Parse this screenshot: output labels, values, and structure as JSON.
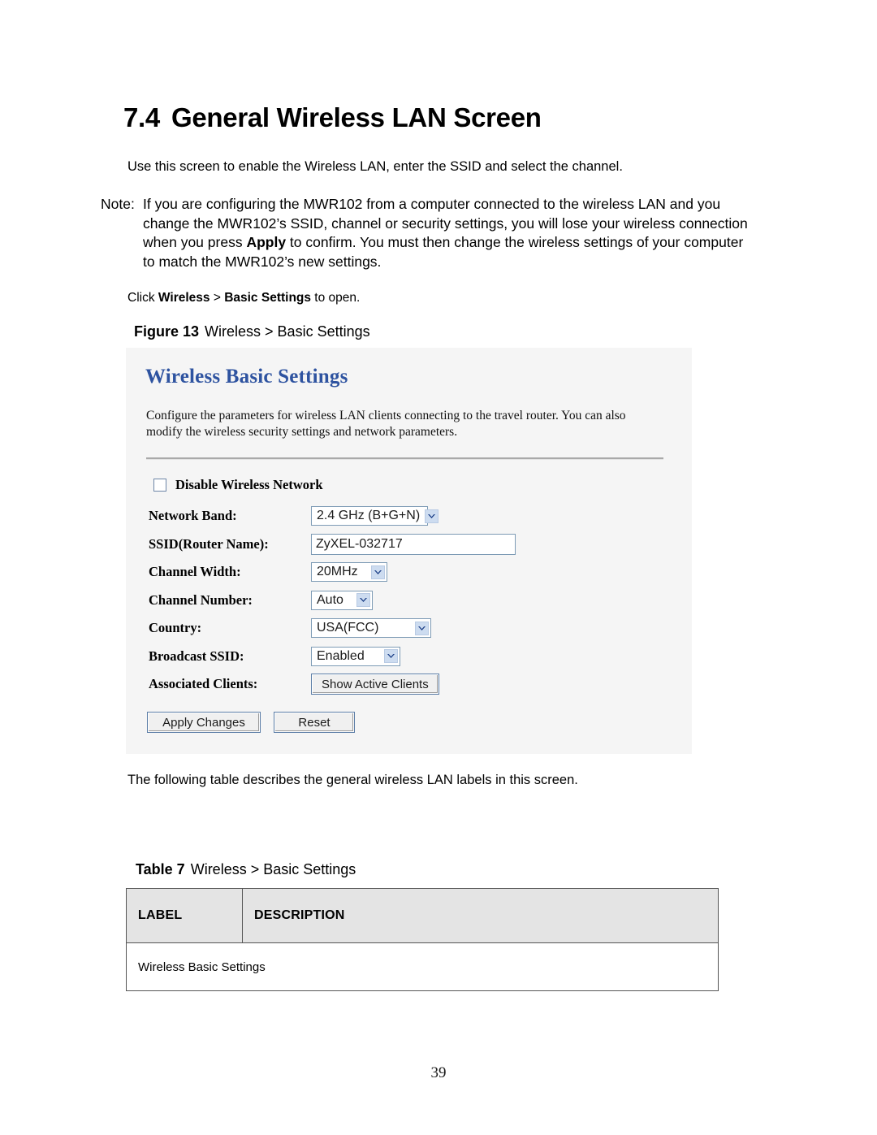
{
  "document": {
    "section_number": "7.4",
    "section_title": "General Wireless LAN Screen",
    "intro": "Use this screen to enable the Wireless LAN, enter the SSID and select the channel.",
    "note": {
      "label": "Note:",
      "part1": "If you are configuring the MWR102 from a computer connected to the wireless LAN and you change the MWR102’s SSID, channel or security settings, you will lose your wireless connection when you press ",
      "emphasis": "Apply",
      "part2": " to confirm. You must then change the wireless settings of your computer to match the MWR102’s new settings."
    },
    "click_instruction": {
      "prefix": "Click ",
      "menu1": "Wireless",
      "separator": " > ",
      "menu2": "Basic Settings",
      "suffix": " to open."
    },
    "figure": {
      "number": "Figure 13",
      "title": "Wireless > Basic Settings"
    },
    "follow_sentence": "The following table describes the general wireless LAN labels in this screen.",
    "table_caption": {
      "number": "Table 7",
      "title": "Wireless > Basic Settings"
    },
    "page_number": "39"
  },
  "router_ui": {
    "title": "Wireless Basic Settings",
    "description": "Configure the parameters for wireless LAN clients connecting to the travel router. You can also modify the wireless security settings and network parameters.",
    "disable_wireless": {
      "label": "Disable Wireless Network",
      "checked": false
    },
    "fields": [
      {
        "label": "Network Band:",
        "control": "select",
        "value": "2.4 GHz (B+G+N)"
      },
      {
        "label": "SSID(Router Name):",
        "control": "text",
        "value": "ZyXEL-032717"
      },
      {
        "label": "Channel Width:",
        "control": "select",
        "value": "20MHz"
      },
      {
        "label": "Channel Number:",
        "control": "select",
        "value": "Auto"
      },
      {
        "label": "Country:",
        "control": "select",
        "value": "USA(FCC)"
      },
      {
        "label": "Broadcast SSID:",
        "control": "select",
        "value": "Enabled"
      },
      {
        "label": "Associated Clients:",
        "control": "button",
        "value": "Show Active Clients"
      }
    ],
    "buttons": {
      "apply": "Apply Changes",
      "reset": "Reset"
    },
    "colors": {
      "panel_background": "#f5f5f5",
      "title_blue": "#2e53a0",
      "control_border": "#7d9bb5",
      "arrow_fill": "#cddcf0"
    }
  },
  "table": {
    "headers": [
      "LABEL",
      "DESCRIPTION"
    ],
    "rows": [
      {
        "label": "Wireless Basic Settings",
        "description": ""
      }
    ]
  }
}
